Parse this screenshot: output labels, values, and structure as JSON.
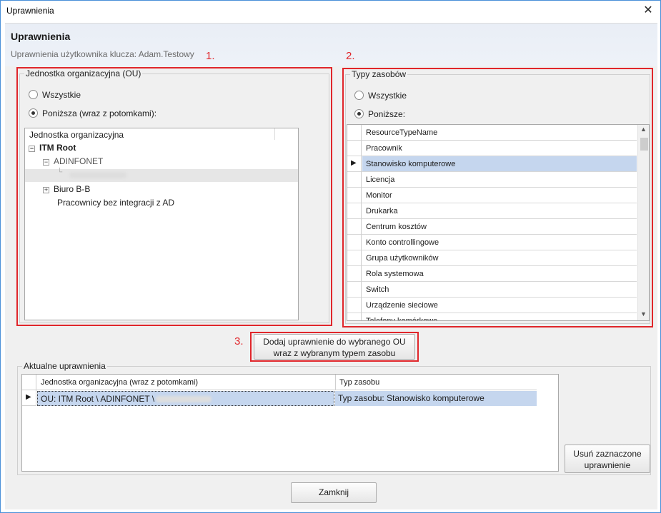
{
  "window": {
    "title": "Uprawnienia",
    "close_glyph": "✕"
  },
  "header": {
    "title": "Uprawnienia",
    "subtitle": "Uprawnienia użytkownika klucza: Adam.Testowy"
  },
  "markers": {
    "one": "1.",
    "two": "2.",
    "three": "3."
  },
  "ou_group": {
    "legend": "Jednostka organizacyjna (OU)",
    "radio_all": "Wszystkie",
    "radio_below": "Poniższa (wraz z potomkami):",
    "selected": "below",
    "tree": {
      "column": "Jednostka organizacyjna",
      "root": "ITM Root",
      "adinfonet": "ADINFONET",
      "biuro": "Biuro B-B",
      "pracownicy": "Pracownicy bez integracji z AD"
    }
  },
  "types_group": {
    "legend": "Typy zasobów",
    "radio_all": "Wszystkie",
    "radio_below": "Poniższe:",
    "selected": "below",
    "column": "ResourceTypeName",
    "rows": [
      "Pracownik",
      "Stanowisko komputerowe",
      "Licencja",
      "Monitor",
      "Drukarka",
      "Centrum kosztów",
      "Konto controllingowe",
      "Grupa użytkowników",
      "Rola systemowa",
      "Switch",
      "Urządzenie sieciowe",
      "Telefony komórkowe"
    ],
    "selected_row": 1
  },
  "add_button": {
    "line1": "Dodaj uprawnienie do wybranego OU",
    "line2": "wraz z wybranym typem zasobu"
  },
  "current": {
    "legend": "Aktualne uprawnienia",
    "col_ou": "Jednostka organizacyjna (wraz z potomkami)",
    "col_type": "Typ zasobu",
    "row_ou": "OU: ITM Root \\ ADINFONET \\",
    "row_type": "Typ zasobu: Stanowisko komputerowe",
    "remove_line1": "Usuń zaznaczone",
    "remove_line2": "uprawnienie"
  },
  "close_button": "Zamknij",
  "colors": {
    "accent_red": "#e0262b",
    "selection": "#c5d6ee",
    "window_border": "#4a90d9"
  }
}
